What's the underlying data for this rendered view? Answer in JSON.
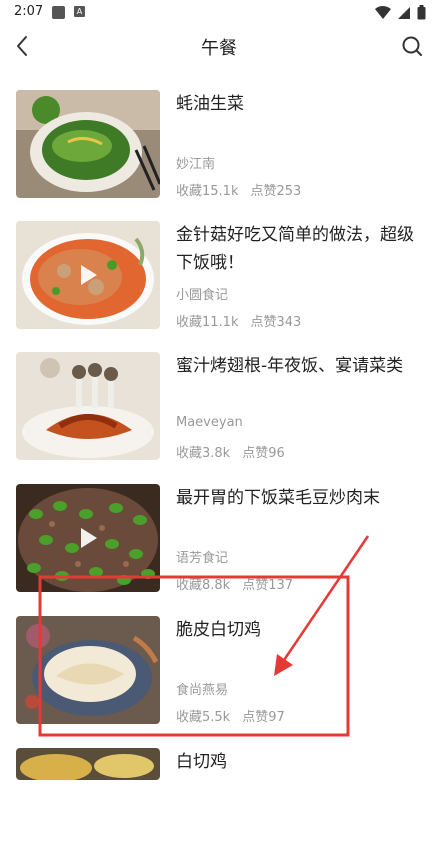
{
  "status_bar": {
    "time": "2:07",
    "badge": "A"
  },
  "header": {
    "title": "午餐"
  },
  "recipes": [
    {
      "title": "蚝油生菜",
      "author": "妙江南",
      "favorites": "收藏15.1k",
      "likes": "点赞253",
      "is_video": false
    },
    {
      "title": "金针菇好吃又简单的做法，超级下饭哦！",
      "author": "小圆食记",
      "favorites": "收藏11.1k",
      "likes": "点赞343",
      "is_video": true
    },
    {
      "title": "蜜汁烤翅根-年夜饭、宴请菜类",
      "author": "Maeveyan",
      "favorites": "收藏3.8k",
      "likes": "点赞96",
      "is_video": false
    },
    {
      "title": "最开胃的下饭菜毛豆炒肉末",
      "author": "语芳食记",
      "favorites": "收藏8.8k",
      "likes": "点赞137",
      "is_video": true
    },
    {
      "title": "脆皮白切鸡",
      "author": "食尚燕易",
      "favorites": "收藏5.5k",
      "likes": "点赞97",
      "is_video": false
    },
    {
      "title": "白切鸡",
      "author": "",
      "favorites": "",
      "likes": "",
      "is_video": false
    }
  ],
  "annotation": {
    "color": "#e53935"
  },
  "icons": {
    "back": "chevron-left-icon",
    "search": "search-icon",
    "play": "play-icon"
  }
}
